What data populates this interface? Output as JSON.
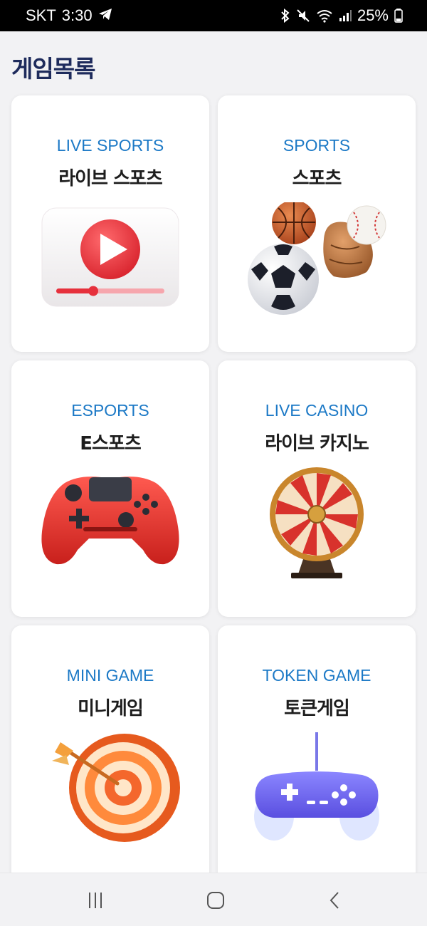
{
  "status": {
    "carrier": "SKT",
    "time": "3:30",
    "battery": "25%",
    "icons": [
      "telegram-icon",
      "bluetooth-icon",
      "mute-icon",
      "wifi-icon",
      "signal-icon",
      "battery-icon"
    ]
  },
  "page": {
    "title": "게임목록"
  },
  "games": [
    {
      "en": "LIVE SPORTS",
      "ko": "라이브 스포츠",
      "icon": "video-player-icon"
    },
    {
      "en": "SPORTS",
      "ko": "스포츠",
      "icon": "sports-balls-icon"
    },
    {
      "en": "ESPORTS",
      "ko": "E스포츠",
      "icon": "gamepad-icon"
    },
    {
      "en": "LIVE CASINO",
      "ko": "라이브 카지노",
      "icon": "roulette-wheel-icon"
    },
    {
      "en": "MINI GAME",
      "ko": "미니게임",
      "icon": "dartboard-icon"
    },
    {
      "en": "TOKEN GAME",
      "ko": "토큰게임",
      "icon": "token-gamepad-icon"
    }
  ],
  "nav": {
    "buttons": [
      "recent-apps-icon",
      "home-icon",
      "back-icon"
    ]
  },
  "colors": {
    "title": "#1e2b5c",
    "accent": "#1c79c6",
    "background": "#f2f2f4"
  }
}
